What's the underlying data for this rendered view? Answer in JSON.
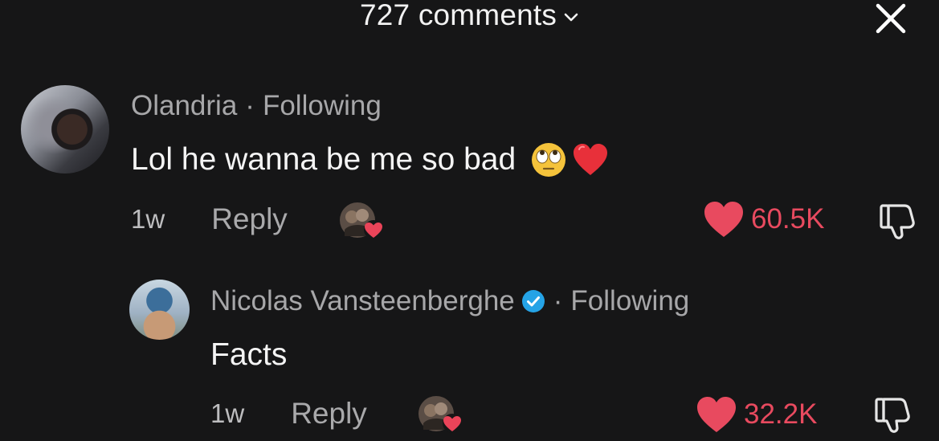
{
  "header": {
    "title": "727 comments",
    "chevron_icon": "chevron-down-icon",
    "close_icon": "close-icon"
  },
  "colors": {
    "background": "#161617",
    "like_red": "#e84a5f",
    "muted_text": "#a7a7a9",
    "verified_blue": "#25a3e6"
  },
  "comments": [
    {
      "author": "Olandria",
      "separator": "·",
      "following_label": "Following",
      "verified": false,
      "text": "Lol he wanna be me so bad",
      "emojis": [
        "face-with-rolling-eyes-emoji",
        "red-heart-emoji"
      ],
      "time": "1w",
      "reply_label": "Reply",
      "likes": "60.5K",
      "creator_liked": true
    },
    {
      "author": "Nicolas Vansteenberghe",
      "separator": "·",
      "following_label": "Following",
      "verified": true,
      "text": "Facts",
      "emojis": [],
      "time": "1w",
      "reply_label": "Reply",
      "likes": "32.2K",
      "creator_liked": true
    }
  ]
}
